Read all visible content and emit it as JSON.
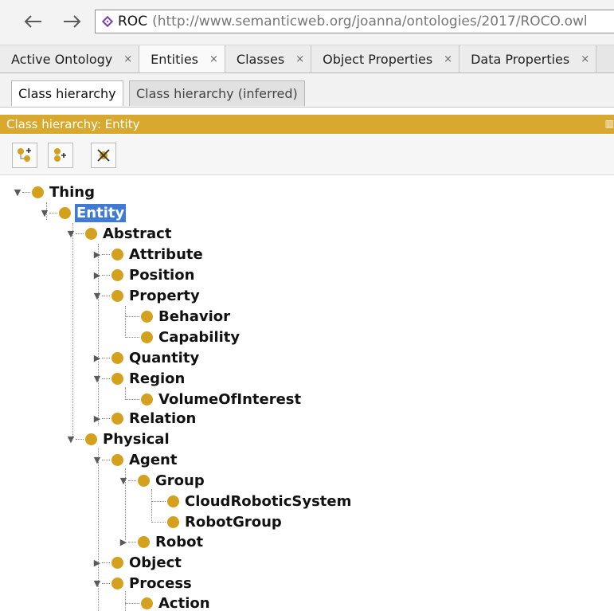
{
  "address_bar": {
    "ontology_name": "ROC",
    "ontology_iri": "(http://www.semanticweb.org/joanna/ontologies/2017/ROCO.owl"
  },
  "tabs": [
    {
      "label": "Active Ontology",
      "close": "×"
    },
    {
      "label": "Entities",
      "close": "×"
    },
    {
      "label": "Classes",
      "close": "×"
    },
    {
      "label": "Object Properties",
      "close": "×"
    },
    {
      "label": "Data Properties",
      "close": "×"
    }
  ],
  "subtabs": {
    "active": "Class hierarchy",
    "inactive": "Class hierarchy (inferred)"
  },
  "view_header": {
    "title": "Class hierarchy: Entity"
  },
  "toolbar": {
    "buttons": [
      "add-subclass-icon",
      "add-sibling-class-icon",
      "delete-class-icon"
    ]
  },
  "tree": {
    "nodes": [
      {
        "label": "Thing",
        "expanded": true
      },
      {
        "label": "Entity",
        "expanded": true,
        "selected": true
      },
      {
        "label": "Abstract",
        "expanded": true
      },
      {
        "label": "Attribute",
        "expanded": false
      },
      {
        "label": "Position",
        "expanded": false
      },
      {
        "label": "Property",
        "expanded": true
      },
      {
        "label": "Behavior"
      },
      {
        "label": "Capability"
      },
      {
        "label": "Quantity",
        "expanded": false
      },
      {
        "label": "Region",
        "expanded": true
      },
      {
        "label": "VolumeOfInterest"
      },
      {
        "label": "Relation",
        "expanded": false
      },
      {
        "label": "Physical",
        "expanded": true
      },
      {
        "label": "Agent",
        "expanded": true
      },
      {
        "label": "Group",
        "expanded": true
      },
      {
        "label": "CloudRoboticSystem"
      },
      {
        "label": "RobotGroup"
      },
      {
        "label": "Robot",
        "expanded": false
      },
      {
        "label": "Object",
        "expanded": false
      },
      {
        "label": "Process",
        "expanded": true
      },
      {
        "label": "Action"
      }
    ]
  },
  "colors": {
    "accent_header": "#d9a82e",
    "class_dot": "#d4a11f",
    "selection": "#3f7bd4"
  }
}
